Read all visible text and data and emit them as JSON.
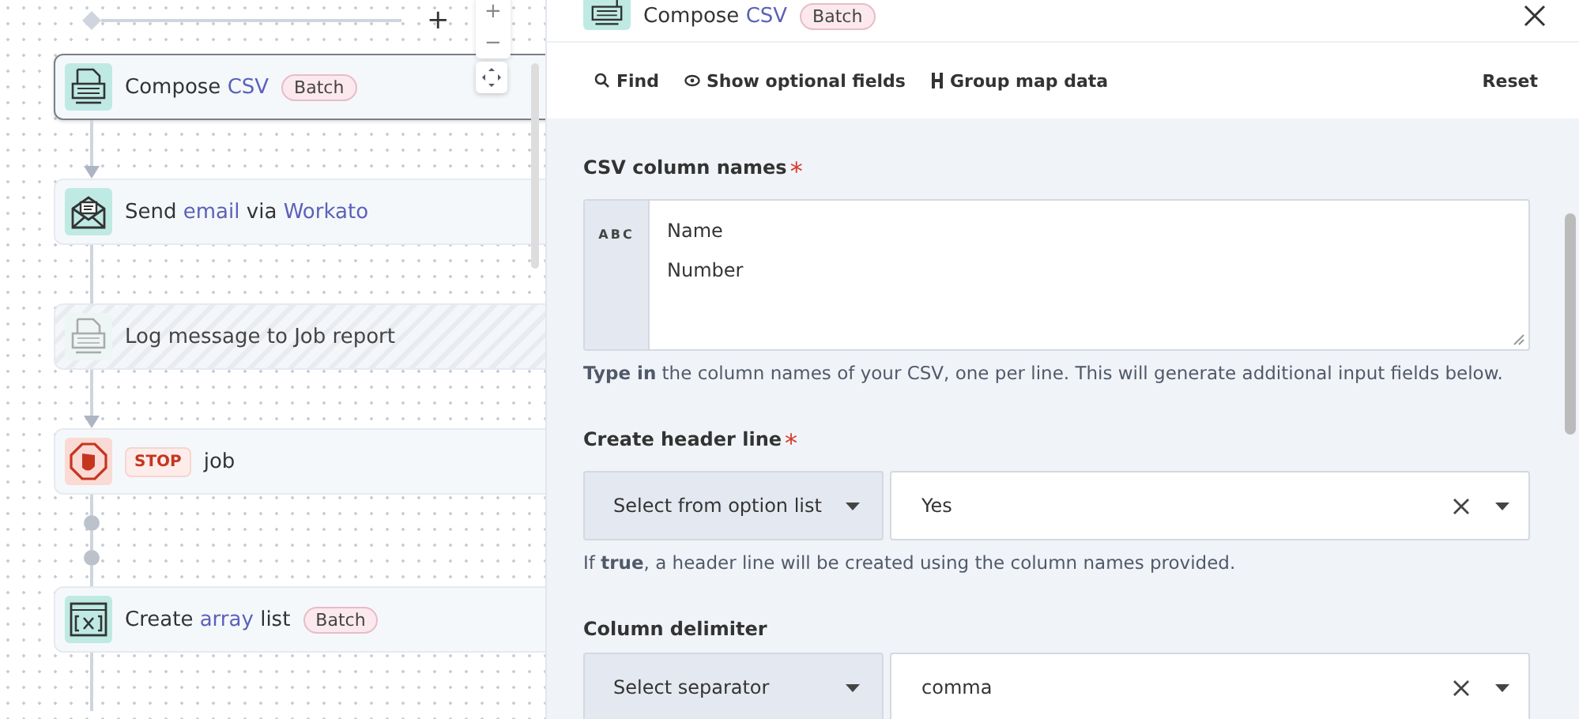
{
  "canvas": {
    "steps": [
      {
        "kind": "csv",
        "title_parts": [
          {
            "text": "Compose",
            "highlight": false
          },
          {
            "text": "CSV",
            "highlight": true
          }
        ],
        "badge": "Batch",
        "selected": true,
        "disabled": false
      },
      {
        "kind": "email",
        "title_parts": [
          {
            "text": "Send",
            "highlight": false
          },
          {
            "text": "email",
            "highlight": true
          },
          {
            "text": "via",
            "highlight": false
          },
          {
            "text": "Workato",
            "highlight": true
          }
        ],
        "selected": false,
        "disabled": false
      },
      {
        "kind": "log",
        "title_parts": [
          {
            "text": "Log message to Job report",
            "highlight": false
          }
        ],
        "selected": false,
        "disabled": true
      },
      {
        "kind": "stop",
        "stop_label": "STOP",
        "title_parts": [
          {
            "text": "job",
            "highlight": false
          }
        ],
        "selected": false,
        "disabled": false
      },
      {
        "kind": "array",
        "title_parts": [
          {
            "text": "Create",
            "highlight": false
          },
          {
            "text": "array",
            "highlight": true
          },
          {
            "text": "list",
            "highlight": false
          }
        ],
        "badge": "Batch",
        "selected": false,
        "disabled": false
      }
    ],
    "add_symbol": "+",
    "zoom_in": "+",
    "zoom_out": "−"
  },
  "panel": {
    "title_parts": [
      {
        "text": "Compose",
        "highlight": false
      },
      {
        "text": "CSV",
        "highlight": true
      }
    ],
    "badge": "Batch",
    "toolbar": [
      "Find",
      "Show optional fields",
      "Group map data"
    ],
    "reset": "Reset",
    "fields": [
      {
        "kind": "textarea",
        "label": "CSV column names",
        "required_mark": "*",
        "prefix": "ABC",
        "value": "Name\nNumber",
        "hint": "**Type in** the column names of your CSV, one per line. This will generate additional input fields below."
      },
      {
        "kind": "select",
        "label": "Create header line",
        "required_mark": "*",
        "mode": "Select from option list",
        "value": "Yes",
        "hint": "If **true**, a header line will be created using the column names provided."
      },
      {
        "kind": "select",
        "label": "Column delimiter",
        "mode": "Select separator",
        "value": "comma"
      }
    ]
  }
}
